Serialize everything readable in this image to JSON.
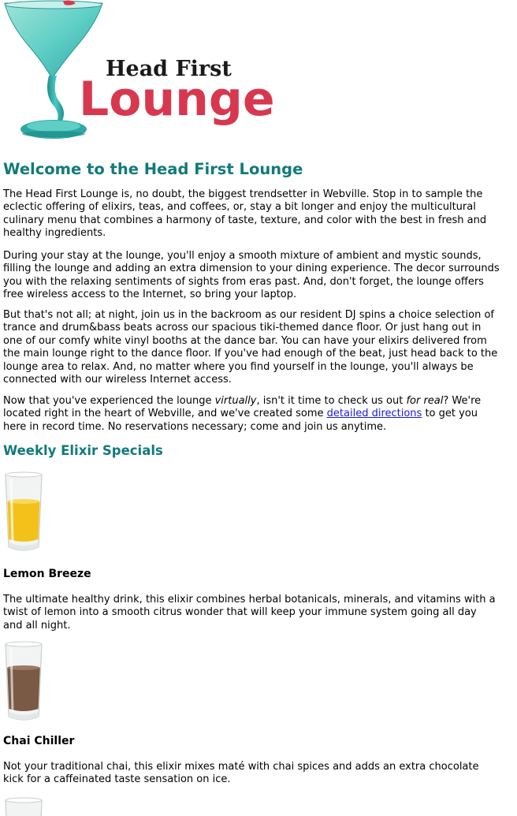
{
  "colors": {
    "heading": "#117a7a",
    "link": "#1a1ad6",
    "logo_red": "#d8384f",
    "logo_dark": "#1a1a1a",
    "glass_teal": "#4cc7c2"
  },
  "logo": {
    "line1": "Head First",
    "line2": "Lounge"
  },
  "title": "Welcome to the Head First Lounge",
  "intro": {
    "p1": [
      "The Head First Lounge is, no doubt, the biggest trendsetter in Webville. Stop in to sample the",
      "eclectic offering of elixirs, teas, and coffees, or, stay a bit longer and enjoy the multicultural",
      "culinary menu that combines a harmony of taste, texture, and color with the best in fresh and",
      "healthy ingredients."
    ],
    "p2": [
      "During your stay at the lounge, you'll enjoy a smooth mixture of ambient and mystic sounds,",
      "filling the lounge and adding an extra dimension to your dining experience. The decor surrounds",
      "you with the relaxing sentiments of sights from eras past. And, don't forget, the lounge offers",
      "free wireless access to the Internet, so bring your laptop."
    ],
    "p3": [
      "But that's not all; at night, join us in the backroom as our resident DJ spins a choice selection of",
      "trance and drum&bass beats across our spacious tiki-themed dance floor. Or just hang out in",
      "one of our comfy white vinyl booths at the dance bar. You can have your elixirs delivered from",
      "the main lounge right to the dance floor. If you've had enough of the beat, just head back to the",
      "lounge area to relax. And, no matter where you find yourself in the lounge, you'll always be",
      "connected with our wireless Internet access."
    ],
    "p4": {
      "line1_a": "Now that you've experienced the lounge ",
      "line1_em1": "virtually",
      "line1_b": ", isn't it time to check us out ",
      "line1_em2": "for real",
      "line1_c": "? We're",
      "line2_a": "located right in the heart of Webville, and we've created some ",
      "link": "detailed directions",
      "line2_b": " to get you",
      "line3": "here in record time. No reservations necessary; come and join us anytime."
    }
  },
  "specials_heading": "Weekly Elixir Specials",
  "elixirs": [
    {
      "name": "Lemon Breeze",
      "liquid_color": "#f3c21a",
      "description": [
        "The ultimate healthy drink, this elixir combines herbal botanicals, minerals, and vitamins with a",
        "twist of lemon into a smooth citrus wonder that will keep your immune system going all day",
        "and all night."
      ]
    },
    {
      "name": "Chai Chiller",
      "liquid_color": "#7a5a45",
      "description": [
        "Not your traditional chai, this elixir mixes maté with chai spices and adds an extra chocolate",
        "kick for a caffeinated taste sensation on ice."
      ]
    }
  ]
}
